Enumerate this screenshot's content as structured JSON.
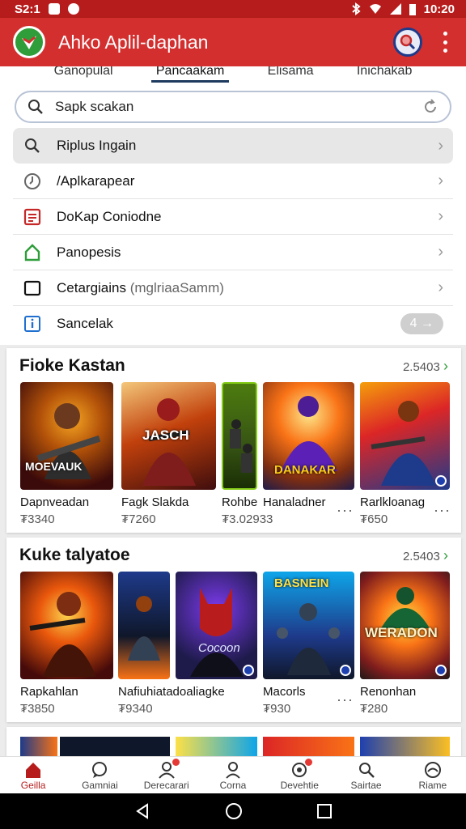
{
  "status": {
    "time_left": "S2:1",
    "time_right": "10:20"
  },
  "app": {
    "title": "Ahko Aplil-daphan"
  },
  "tabs": [
    "Ganopulal",
    "Pancaakam",
    "Elisama",
    "Inichakab"
  ],
  "search": {
    "placeholder": "Sapk scakan"
  },
  "menu": [
    {
      "label": "Riplus Ingain",
      "icon": "search-icon"
    },
    {
      "label": "/Aplkarapear",
      "icon": "clock-icon"
    },
    {
      "label": "DoKap Coniodne",
      "icon": "document-icon"
    },
    {
      "label": "Panopesis",
      "icon": "home-icon"
    },
    {
      "label": "Cetargiains",
      "sub": "(mglriaaSamm)",
      "icon": "square-icon"
    },
    {
      "label": "Sancelak",
      "icon": "info-icon",
      "pill": "4 →"
    }
  ],
  "sections": [
    {
      "title": "Fioke Kastan",
      "link": "2.5403",
      "link_arrow": "›",
      "games": [
        {
          "name": "Dapnveadan",
          "value": "₮3340",
          "art_text": "MOEVAUK"
        },
        {
          "name": "Fagk Slakda",
          "value": "₮7260",
          "art_text": "JASCH"
        },
        {
          "name": "Rohbe",
          "value": "₮3.02933",
          "art_text": ""
        },
        {
          "name": "Hanaladner",
          "value": "",
          "art_text": "DANAKAR"
        },
        {
          "name": "Rarlkloanag",
          "value": "₮650",
          "art_text": ""
        }
      ]
    },
    {
      "title": "Kuke talyatoe",
      "link": "2.5403",
      "link_arrow": "›",
      "games": [
        {
          "name": "Rapkahlan",
          "value": "₮3850",
          "art_text": ""
        },
        {
          "name": "Nafiuhiatadoaliagke",
          "value": "₮9340",
          "art_text": ""
        },
        {
          "name": "",
          "value": "",
          "art_text": "Cocoon"
        },
        {
          "name": "Macorls",
          "value": "₮930",
          "art_text": "BASNEIN"
        },
        {
          "name": "Renonhan",
          "value": "₮280",
          "art_text": "WERADON"
        }
      ]
    }
  ],
  "bottom_nav": [
    {
      "label": "Geilla",
      "icon": "home-icon"
    },
    {
      "label": "Gamniai",
      "icon": "chat-icon"
    },
    {
      "label": "Derecarari",
      "icon": "people-icon"
    },
    {
      "label": "Corna",
      "icon": "person-icon"
    },
    {
      "label": "Devehtie",
      "icon": "settings-icon"
    },
    {
      "label": "Sairtae",
      "icon": "search-icon"
    },
    {
      "label": "Riame",
      "icon": "profile-icon"
    }
  ],
  "colors": {
    "primary": "#d32f2f",
    "status": "#b71c1c",
    "accent": "#2e9d3a",
    "badge": "#1e40af"
  }
}
